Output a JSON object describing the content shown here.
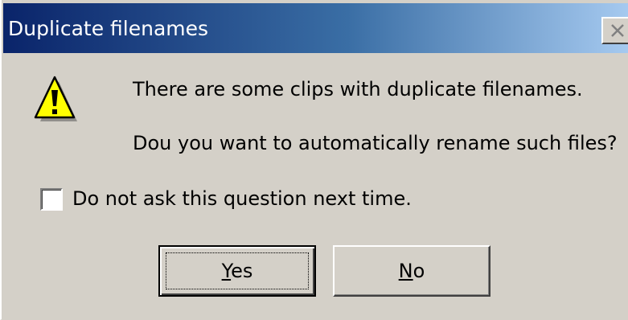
{
  "dialog": {
    "title": "Duplicate filenames",
    "close_icon": "close-icon",
    "warning_icon": "warning-icon",
    "message_line1": "There are some clips with duplicate filenames.",
    "message_line2": "Dou you want to automatically rename such files?",
    "checkbox": {
      "label": "Do not ask this question next time.",
      "checked": false
    },
    "buttons": {
      "yes": {
        "mnemonic": "Y",
        "rest": "es"
      },
      "no": {
        "mnemonic": "N",
        "rest": "o"
      }
    }
  },
  "colors": {
    "titlebar_start": "#0a246a",
    "titlebar_end": "#a6caf0",
    "face": "#d4d0c8",
    "warning_yellow": "#ffff00"
  }
}
